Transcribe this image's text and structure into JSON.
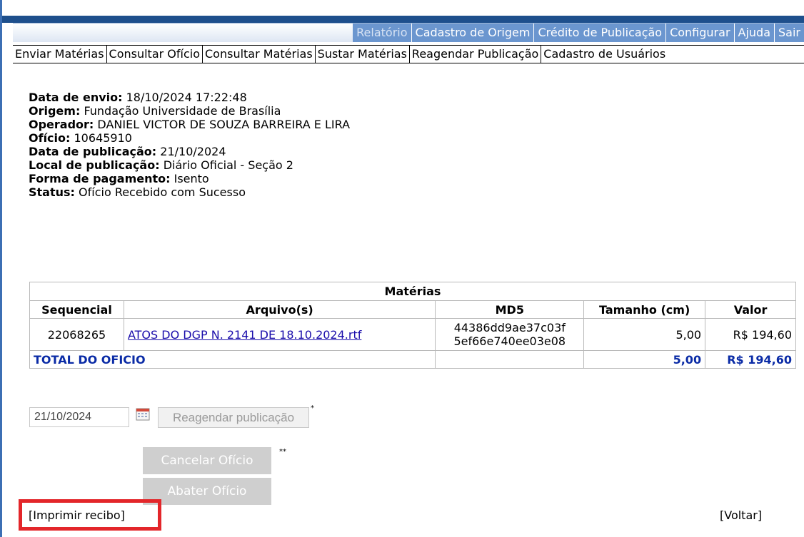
{
  "menu": {
    "items": [
      "Relatório",
      "Cadastro de Origem",
      "Crédito de Publicação",
      "Configurar",
      "Ajuda",
      "Sair"
    ]
  },
  "subnav": {
    "items": [
      "Enviar Matérias",
      "Consultar Ofício",
      "Consultar Matérias",
      "Sustar Matérias",
      "Reagendar Publicação",
      "Cadastro de Usuários"
    ]
  },
  "info": {
    "data_envio_label": "Data de envio:",
    "data_envio_value": " 18/10/2024 17:22:48",
    "origem_label": "Origem:",
    "origem_value": " Fundação Universidade de Brasília",
    "operador_label": "Operador:",
    "operador_value": " DANIEL VICTOR DE SOUZA BARREIRA E LIRA",
    "oficio_label": "Ofício:",
    "oficio_value": " 10645910",
    "data_publicacao_label": "Data de publicação:",
    "data_publicacao_value": " 21/10/2024",
    "local_label": "Local de publicação:",
    "local_value": " Diário Oficial - Seção 2",
    "forma_label": "Forma de pagamento:",
    "forma_value": " Isento",
    "status_label": "Status:",
    "status_value": " Ofício Recebido com Sucesso"
  },
  "table": {
    "caption": "Matérias",
    "headers": [
      "Sequencial",
      "Arquivo(s)",
      "MD5",
      "Tamanho (cm)",
      "Valor"
    ],
    "row": {
      "sequencial": "22068265",
      "arquivo": "ATOS DO DGP N. 2141 DE 18.10.2024.rtf",
      "md5_line1": "44386dd9ae37c03f",
      "md5_line2": "5ef66e740ee03e08",
      "tamanho": "5,00",
      "valor": "R$ 194,60"
    },
    "total": {
      "label": "TOTAL DO OFICIO",
      "tamanho": "5,00",
      "valor": "R$ 194,60"
    }
  },
  "reschedule": {
    "date_value": "21/10/2024",
    "button_label": "Reagendar publicação",
    "note_marker": "*"
  },
  "actions": {
    "cancelar_label": "Cancelar Ofício",
    "abater_label": "Abater Ofício",
    "note_marker": "**",
    "imprimir_label": "[Imprimir recibo]",
    "voltar_label": "[Voltar]"
  },
  "colors": {
    "menu_bg": "#6b96cf",
    "top_strip": "#1e4f8c",
    "total_text": "#0a2ba6",
    "link": "#1a0dab",
    "highlight": "#e3262a"
  }
}
